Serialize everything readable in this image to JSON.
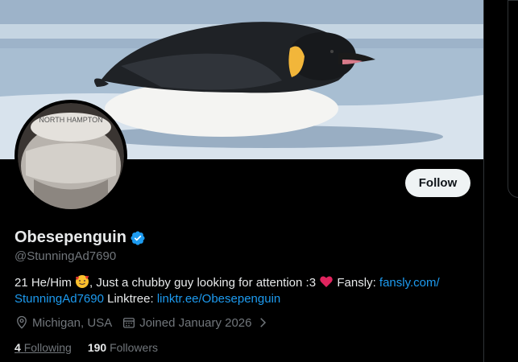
{
  "profile": {
    "display_name": "Obesepenguin",
    "handle": "@StunningAd7690",
    "follow_label": "Follow",
    "bio": {
      "part1": "21 He/Him ",
      "part2": ", Just a chubby guy looking for attention :3 ",
      "part3": " Fansly: ",
      "fansly_link": "fansly.com/​StunningAd7690",
      "part4": " Linktree: ",
      "linktree_link": "linktr.ee/Obesepenguin"
    },
    "location": "Michigan, USA",
    "joined": "Joined January 2026",
    "following_count": "4",
    "following_label": "Following",
    "followers_count": "190",
    "followers_label": "Followers"
  },
  "colors": {
    "accent": "#1d9bf0",
    "verified": "#1d9bf0",
    "background": "#000000"
  }
}
